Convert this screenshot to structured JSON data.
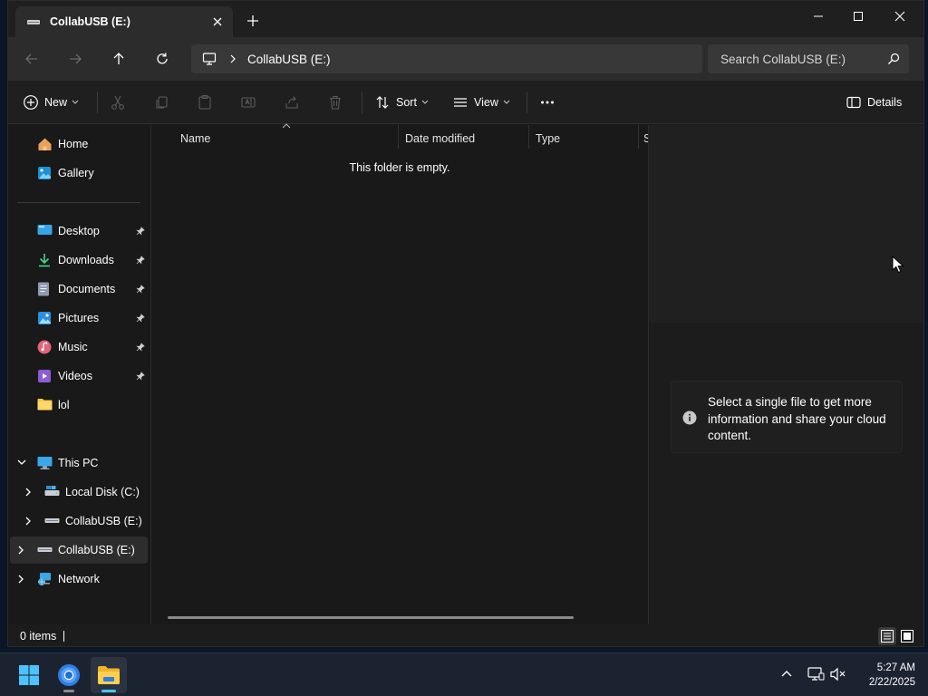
{
  "window": {
    "tab_title": "CollabUSB (E:)",
    "minimize_label": "Minimize",
    "maximize_label": "Maximize",
    "close_label": "Close"
  },
  "address": {
    "crumb": "CollabUSB (E:)"
  },
  "search": {
    "placeholder": "Search CollabUSB (E:)"
  },
  "commandbar": {
    "new_label": "New",
    "sort_label": "Sort",
    "view_label": "View",
    "details_label": "Details"
  },
  "sidebar": {
    "quick": [
      {
        "label": "Home",
        "icon": "home-icon"
      },
      {
        "label": "Gallery",
        "icon": "gallery-icon"
      }
    ],
    "pinned": [
      {
        "label": "Desktop",
        "icon": "desktop-icon"
      },
      {
        "label": "Downloads",
        "icon": "downloads-icon"
      },
      {
        "label": "Documents",
        "icon": "documents-icon"
      },
      {
        "label": "Pictures",
        "icon": "pictures-icon"
      },
      {
        "label": "Music",
        "icon": "music-icon"
      },
      {
        "label": "Videos",
        "icon": "videos-icon"
      },
      {
        "label": "lol",
        "icon": "folder-icon"
      }
    ],
    "tree": [
      {
        "label": "This PC",
        "icon": "this-pc-icon"
      },
      {
        "label": "Local Disk (C:)",
        "icon": "local-disk-icon"
      },
      {
        "label": "CollabUSB (E:)",
        "icon": "usb-drive-icon"
      },
      {
        "label": "CollabUSB (E:)",
        "icon": "usb-drive-icon"
      },
      {
        "label": "Network",
        "icon": "network-icon"
      }
    ]
  },
  "content": {
    "columns": [
      "Name",
      "Date modified",
      "Type",
      "S"
    ],
    "empty_message": "This folder is empty."
  },
  "details": {
    "message": "Select a single file to get more information and share your cloud content."
  },
  "status": {
    "item_count": "0 items"
  },
  "taskbar": {
    "time": "5:27 AM",
    "date": "2/22/2025"
  },
  "colors": {
    "window_bg": "#191919",
    "toolbar_bg": "#2c2c2c",
    "accent_blue": "#4cc2ff",
    "folder_yellow": "#f7c948"
  }
}
